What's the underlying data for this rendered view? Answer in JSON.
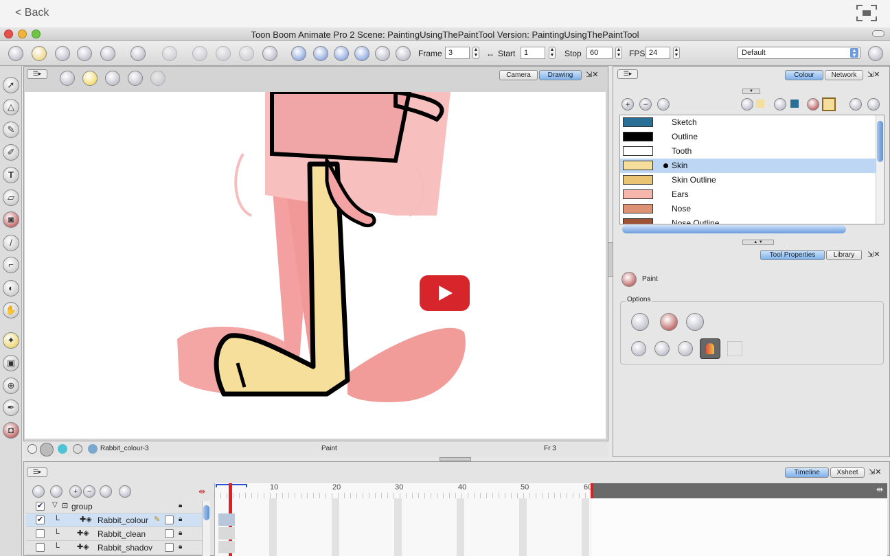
{
  "nav": {
    "back_label": "< Back"
  },
  "window": {
    "title": "Toon Boom Animate Pro 2 Scene: PaintingUsingThePaintTool Version: PaintingUsingThePaintTool"
  },
  "toolbar": {
    "frame_label": "Frame",
    "frame_value": "3",
    "start_label": "Start",
    "start_value": "1",
    "stop_label": "Stop",
    "stop_value": "60",
    "fps_label": "FPS",
    "fps_value": "24",
    "workspace_select": "Default"
  },
  "view": {
    "tabs": [
      {
        "label": "Camera"
      },
      {
        "label": "Drawing"
      }
    ],
    "status_layer": "Rabbit_colour-3",
    "status_tool": "Paint",
    "status_frame": "Fr 3"
  },
  "colour_panel": {
    "tabs": [
      {
        "label": "Colour"
      },
      {
        "label": "Network"
      }
    ],
    "colours": [
      {
        "name": "Sketch",
        "color": "#2a6f96"
      },
      {
        "name": "Outline",
        "color": "#000000"
      },
      {
        "name": "Tooth",
        "color": "#ffffff"
      },
      {
        "name": "Skin",
        "color": "#f5de9c"
      },
      {
        "name": "Skin Outline",
        "color": "#e9c573"
      },
      {
        "name": "Ears",
        "color": "#f6b6ab"
      },
      {
        "name": "Nose",
        "color": "#dc9273"
      },
      {
        "name": "Nose Outline",
        "color": "#9e5236"
      }
    ]
  },
  "tool_panel": {
    "tabs": [
      {
        "label": "Tool Properties"
      },
      {
        "label": "Library"
      }
    ],
    "tool_name": "Paint",
    "options_label": "Options"
  },
  "timeline": {
    "tabs": [
      {
        "label": "Timeline"
      },
      {
        "label": "Xsheet"
      }
    ],
    "ruler": [
      "10",
      "20",
      "30",
      "40",
      "50",
      "60"
    ],
    "layers": [
      {
        "name": "group"
      },
      {
        "name": "Rabbit_colour"
      },
      {
        "name": "Rabbit_clean"
      },
      {
        "name": "Rabbit_shadov"
      }
    ]
  },
  "colors": {
    "accent": "#7fb2ec",
    "playhead": "#e02020",
    "play_badge": "#d7262b"
  }
}
